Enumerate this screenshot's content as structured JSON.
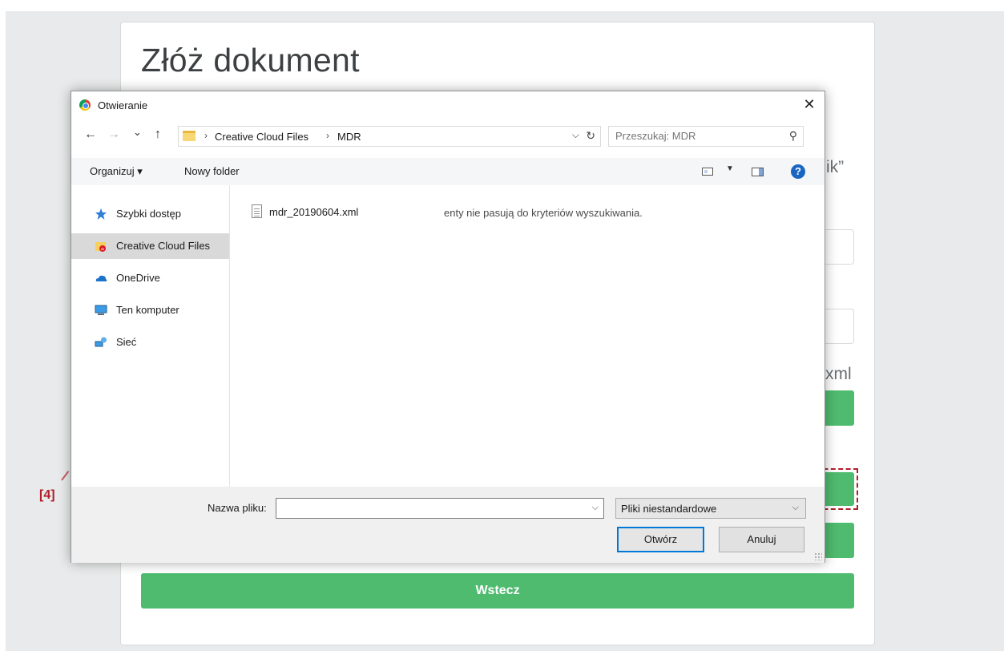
{
  "page": {
    "title": "Złóż dokument",
    "partial_right_1": "ik”",
    "partial_right_2": "xml",
    "back_button": "Wstecz",
    "annotation": "[4]"
  },
  "dialog": {
    "title": "Otwieranie",
    "close": "✕",
    "nav": {
      "back": "←",
      "forward": "→",
      "recent": "⌄",
      "up": "↑"
    },
    "breadcrumb": [
      "Creative Cloud Files",
      "MDR"
    ],
    "search_placeholder": "Przeszukaj: MDR",
    "toolbar": {
      "organize": "Organizuj ▾",
      "new_folder": "Nowy folder"
    },
    "sidebar": [
      {
        "label": "Szybki dostęp",
        "icon": "star-icon"
      },
      {
        "label": "Creative Cloud Files",
        "icon": "creative-cloud-folder-icon",
        "selected": true
      },
      {
        "label": "OneDrive",
        "icon": "onedrive-cloud-icon"
      },
      {
        "label": "Ten komputer",
        "icon": "computer-icon"
      },
      {
        "label": "Sieć",
        "icon": "network-icon"
      }
    ],
    "files": [
      {
        "name": "mdr_20190604.xml"
      }
    ],
    "empty_message": "enty nie pasują do kryteriów wyszukiwania.",
    "filename_label": "Nazwa pliku:",
    "filename_value": "",
    "filter": "Pliki niestandardowe",
    "open_button": "Otwórz",
    "cancel_button": "Anuluj"
  },
  "colors": {
    "green": "#4fbb6f",
    "annotation_red": "#b0202a",
    "accent_blue": "#0078d7"
  }
}
